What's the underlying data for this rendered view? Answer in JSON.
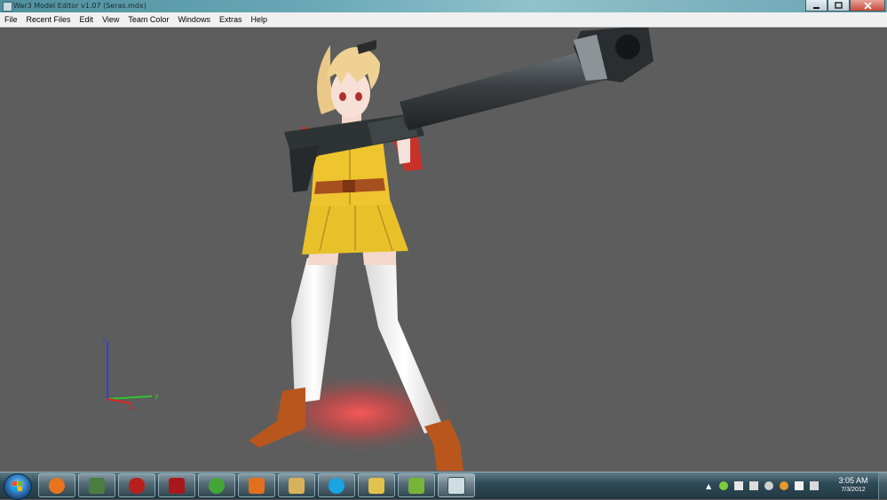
{
  "window": {
    "title": "War3 Model Editor v1.07 (Seras.mdx)",
    "controls": {
      "minimize_icon": "minimize-icon",
      "maximize_icon": "maximize-icon",
      "close_icon": "close-icon"
    }
  },
  "menu": {
    "items": [
      "File",
      "Recent Files",
      "Edit",
      "View",
      "Team Color",
      "Windows",
      "Extras",
      "Help"
    ]
  },
  "viewport": {
    "background": "#5d5d5d",
    "axis_labels": {
      "z": "z",
      "y": "y",
      "x": "x"
    },
    "axis_colors": {
      "z": "#3a3ad8",
      "y": "#2fc42f",
      "x": "#e02020"
    },
    "ground_glow": "#ff4a4a"
  },
  "taskbar": {
    "start_icon": "windows-start-icon",
    "buttons": [
      {
        "name": "firefox-icon",
        "color": "#e8741e"
      },
      {
        "name": "device-manager-icon",
        "color": "#4b7d43"
      },
      {
        "name": "red-bag-icon",
        "color": "#b7201d"
      },
      {
        "name": "garena-icon",
        "color": "#a8171b"
      },
      {
        "name": "utorrent-icon",
        "color": "#43a636"
      },
      {
        "name": "media-player-icon",
        "color": "#e26f1d"
      },
      {
        "name": "file-explorer-icon",
        "color": "#d8b25a"
      },
      {
        "name": "skype-icon",
        "color": "#1aa4e4"
      },
      {
        "name": "folder-icon",
        "color": "#e1c24c"
      },
      {
        "name": "notepad-icon",
        "color": "#78b43a"
      },
      {
        "name": "model-editor-icon",
        "color": "#cfdde3"
      }
    ],
    "tray": {
      "icons": [
        "network-icon",
        "volume-icon",
        "battery-icon",
        "antivirus-icon",
        "update-icon",
        "flag-icon",
        "monitor-icon"
      ],
      "time": "3:05 AM",
      "date": "7/3/2012"
    }
  }
}
